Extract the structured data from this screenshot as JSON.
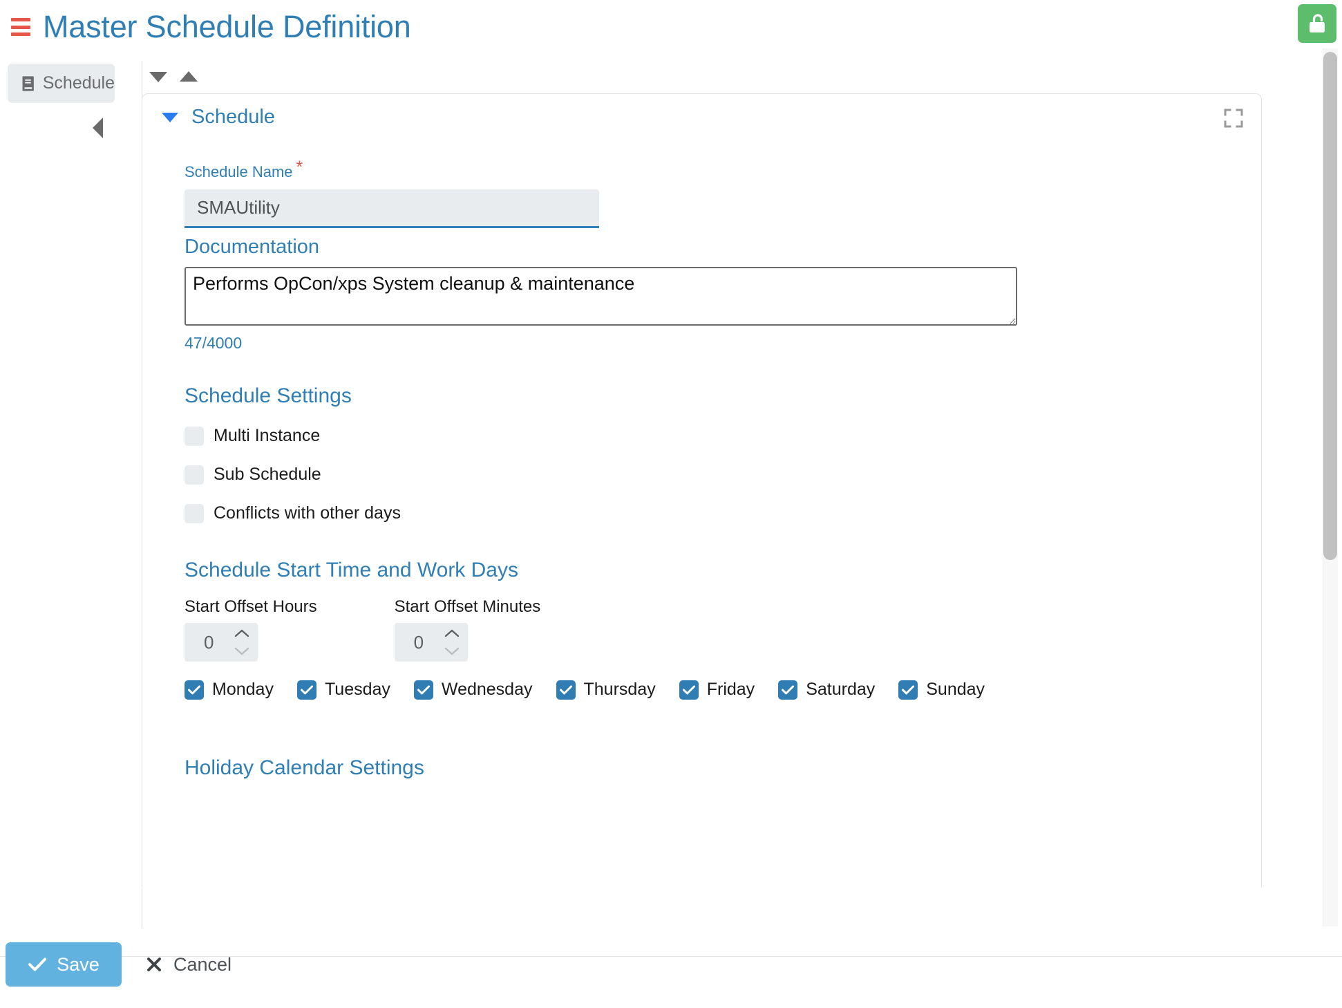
{
  "header": {
    "menu_icon": "hamburger-menu-icon",
    "title": "Master Schedule Definition",
    "lock_icon": "unlock-icon",
    "lock_color": "#5cbd6d",
    "accent_color": "#2f7fb5",
    "menu_color": "#e8564a"
  },
  "sidebar": {
    "items": [
      {
        "label": "Schedule",
        "icon": "book-icon",
        "active": true
      }
    ],
    "collapse_icon": "caret-left-icon"
  },
  "toolbar": {
    "collapse_all_icon": "caret-down-icon",
    "expand_all_icon": "caret-up-icon"
  },
  "card": {
    "title": "Schedule",
    "caret_icon": "caret-down-icon",
    "expand_icon": "fullscreen-icon",
    "schedule_name": {
      "label": "Schedule Name",
      "required_marker": "*",
      "value": "SMAUtility",
      "placeholder": ""
    },
    "documentation": {
      "label": "Documentation",
      "value": "Performs OpCon/xps System cleanup & maintenance",
      "placeholder": "",
      "char_count": "47/4000"
    },
    "schedule_settings": {
      "heading": "Schedule Settings",
      "options": [
        {
          "label": "Multi Instance",
          "checked": false
        },
        {
          "label": "Sub Schedule",
          "checked": false
        },
        {
          "label": "Conflicts with other days",
          "checked": false
        }
      ]
    },
    "start_time": {
      "heading": "Schedule Start Time and Work Days",
      "offset_hours": {
        "label": "Start Offset Hours",
        "value": "0"
      },
      "offset_minutes": {
        "label": "Start Offset Minutes",
        "value": "0"
      },
      "days": [
        {
          "label": "Monday",
          "checked": true
        },
        {
          "label": "Tuesday",
          "checked": true
        },
        {
          "label": "Wednesday",
          "checked": true
        },
        {
          "label": "Thursday",
          "checked": true
        },
        {
          "label": "Friday",
          "checked": true
        },
        {
          "label": "Saturday",
          "checked": true
        },
        {
          "label": "Sunday",
          "checked": true
        }
      ]
    },
    "holiday_calendar": {
      "heading": "Holiday Calendar Settings"
    }
  },
  "footer": {
    "save_label": "Save",
    "save_icon": "check-icon",
    "save_color": "#62b2e0",
    "cancel_label": "Cancel",
    "cancel_icon": "close-x-icon"
  }
}
